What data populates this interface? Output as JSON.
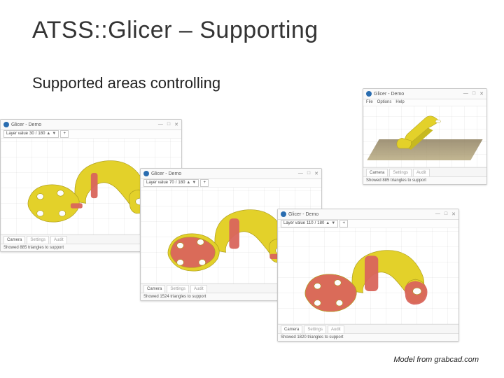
{
  "title": "ATSS::Glicer – Supporting",
  "subtitle": "Supported areas controlling",
  "credit": "Model from grabcad.com",
  "app_title": "Glicer - Demo",
  "menu": {
    "file": "File",
    "options": "Options",
    "help": "Help"
  },
  "layer_ctrl": {
    "label": "Layer value",
    "of": "/",
    "max": "180"
  },
  "tabs": {
    "camera": "Camera",
    "settings": "Settings",
    "audit": "Audit"
  },
  "windows": {
    "a": {
      "layer_value": "30",
      "status": "Showed 885 triangles to support"
    },
    "b": {
      "layer_value": "70",
      "status": "Showed 1524 triangles to support"
    },
    "c": {
      "layer_value": "110",
      "status": "Showed 1820 triangles to support"
    },
    "d": {
      "status": "Showed 885 triangles to support"
    }
  }
}
